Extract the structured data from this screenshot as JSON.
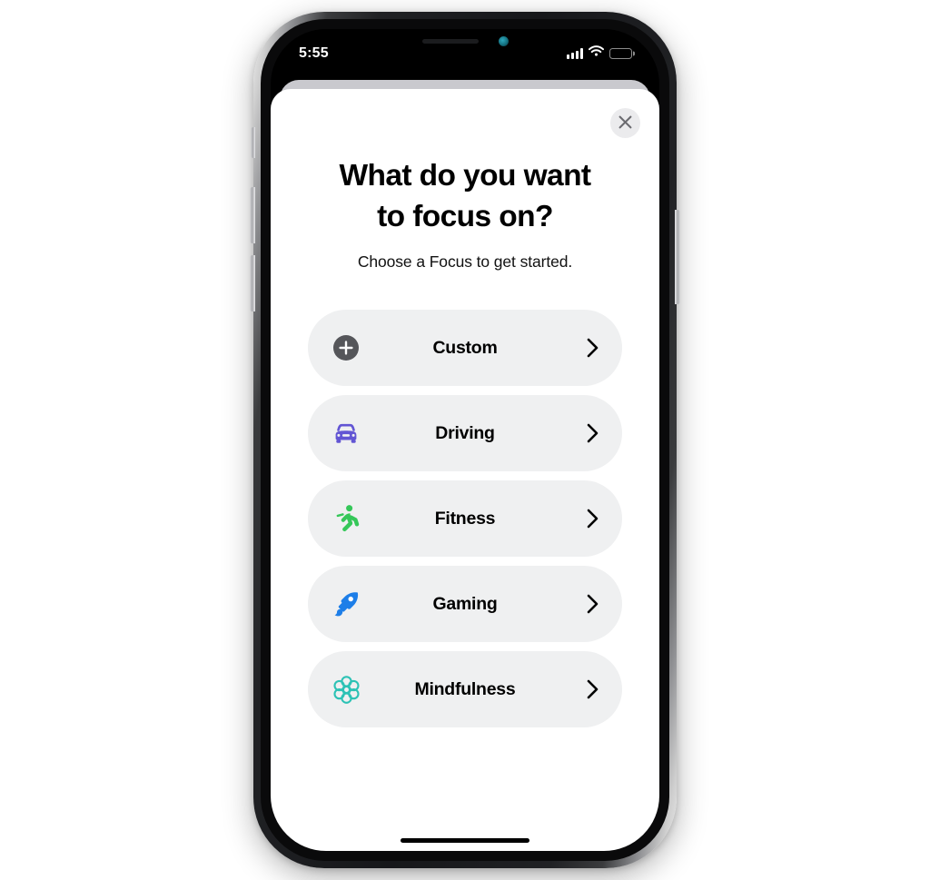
{
  "device": {
    "name": "iphone-x",
    "status_bar": {
      "time": "5:55",
      "signal_icon": "cellular-signal-icon",
      "signal_bars_filled": 4,
      "wifi_icon": "wifi-icon",
      "battery_icon": "battery-icon",
      "battery_level_percent": 72
    },
    "home_indicator": "home-indicator"
  },
  "sheet": {
    "close_label": "✕",
    "close_icon": "close-x-icon",
    "title": "What do you want to focus on?",
    "title_line_1": "What do you want",
    "title_line_2": "to focus on?",
    "subtitle": "Choose a Focus to get started."
  },
  "focus_list": {
    "items": [
      {
        "label": "Custom",
        "icon": "plus-circle-icon",
        "color": "#55565a",
        "chevron": "chevron-right-icon"
      },
      {
        "label": "Driving",
        "icon": "car-icon",
        "color": "#6255d4",
        "chevron": "chevron-right-icon"
      },
      {
        "label": "Fitness",
        "icon": "running-person-icon",
        "color": "#35c759",
        "chevron": "chevron-right-icon"
      },
      {
        "label": "Gaming",
        "icon": "rocket-icon",
        "color": "#1d7ee8",
        "chevron": "chevron-right-icon"
      },
      {
        "label": "Mindfulness",
        "icon": "flower-rosette-icon",
        "color": "#2cc2b5",
        "chevron": "chevron-right-icon"
      }
    ]
  },
  "colors": {
    "sheet_background": "#ffffff",
    "row_background": "#eff0f1",
    "stacked_card": "#c9c9ce",
    "close_button_background": "#ebebed",
    "text_primary": "#000000"
  }
}
